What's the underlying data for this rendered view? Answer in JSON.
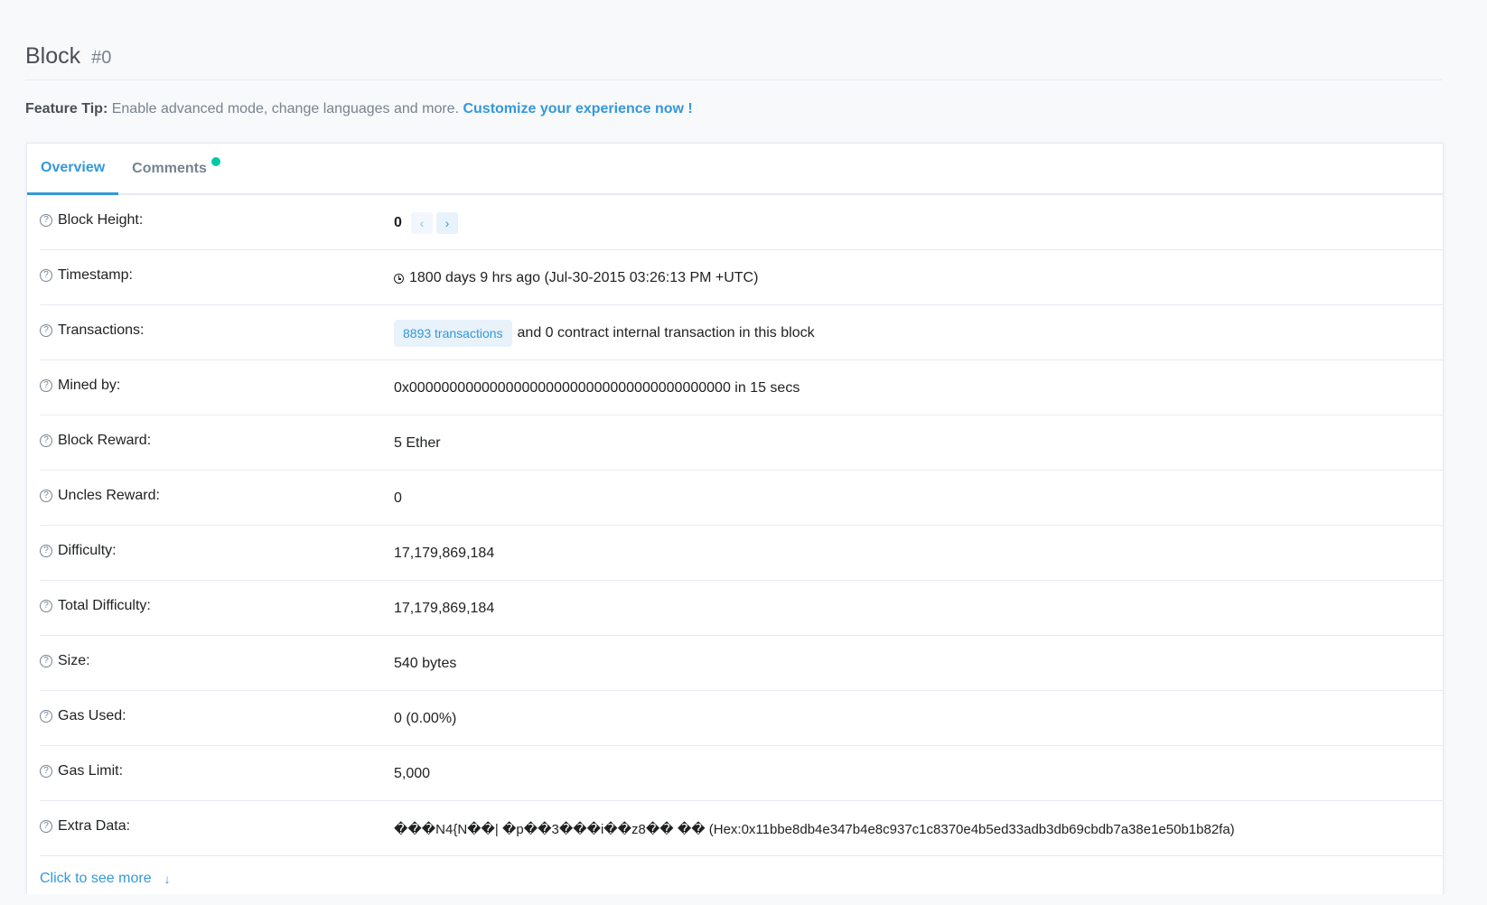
{
  "header": {
    "title": "Block",
    "subtitle": "#0"
  },
  "feature_tip": {
    "label": "Feature Tip:",
    "text": "Enable advanced mode, change languages and more.",
    "link": "Customize your experience now !"
  },
  "tabs": [
    {
      "label": "Overview",
      "active": true
    },
    {
      "label": "Comments",
      "active": false,
      "has_dot": true
    }
  ],
  "colors": {
    "accent": "#3498db",
    "dot": "#00c9a7"
  },
  "rows": {
    "block_height": {
      "label": "Block Height:",
      "value": "0",
      "prev_icon": "chevron-left-icon",
      "next_icon": "chevron-right-icon"
    },
    "timestamp": {
      "label": "Timestamp:",
      "value": "1800 days 9 hrs ago (Jul-30-2015 03:26:13 PM +UTC)"
    },
    "transactions": {
      "label": "Transactions:",
      "badge": "8893 transactions",
      "suffix": "and 0 contract internal transaction in this block"
    },
    "mined_by": {
      "label": "Mined by:",
      "value": "0x0000000000000000000000000000000000000000 in 15 secs"
    },
    "block_reward": {
      "label": "Block Reward:",
      "value": "5 Ether"
    },
    "uncles_reward": {
      "label": "Uncles Reward:",
      "value": "0"
    },
    "difficulty": {
      "label": "Difficulty:",
      "value": "17,179,869,184"
    },
    "total_difficulty": {
      "label": "Total Difficulty:",
      "value": "17,179,869,184"
    },
    "size": {
      "label": "Size:",
      "value": "540 bytes"
    },
    "gas_used": {
      "label": "Gas Used:",
      "value": "0 (0.00%)"
    },
    "gas_limit": {
      "label": "Gas Limit:",
      "value": "5,000"
    },
    "extra_data": {
      "label": "Extra Data:",
      "value": "���N4{N��| �p��3���i��z8��  �� (Hex:0x11bbe8db4e347b4e8c937c1c8370e4b5ed33adb3db69cbdb7a38e1e50b1b82fa)"
    }
  },
  "see_more": {
    "label": "Click to see more",
    "icon": "arrow-down-icon"
  }
}
